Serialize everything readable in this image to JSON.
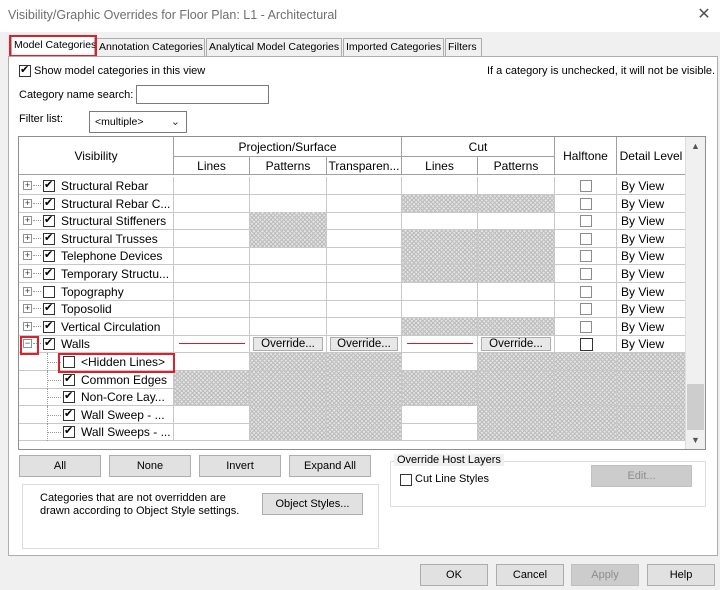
{
  "window": {
    "title": "Visibility/Graphic Overrides for Floor Plan: L1 - Architectural",
    "close_glyph": "✕"
  },
  "tabs": [
    {
      "label": "Model Categories",
      "active": true
    },
    {
      "label": "Annotation Categories"
    },
    {
      "label": "Analytical Model Categories"
    },
    {
      "label": "Imported Categories"
    },
    {
      "label": "Filters"
    }
  ],
  "show_model": {
    "label": "Show model categories in this view",
    "checked": true
  },
  "hint": "If a category is unchecked, it will not be visible.",
  "search": {
    "label": "Category name search:",
    "value": ""
  },
  "filter": {
    "label": "Filter list:",
    "value": "<multiple>"
  },
  "headers": {
    "visibility": "Visibility",
    "projection": "Projection/Surface",
    "cut": "Cut",
    "halftone": "Halftone",
    "detail_level": "Detail Level",
    "lines": "Lines",
    "patterns": "Patterns",
    "transparency": "Transparen...",
    "cut_lines": "Lines",
    "cut_patterns": "Patterns"
  },
  "rows": [
    {
      "name": "Structural Rebar",
      "checked": true,
      "expander": "+",
      "hatch": [],
      "detail": "By View"
    },
    {
      "name": "Structural Rebar C...",
      "checked": true,
      "expander": "+",
      "hatch": [
        "cut_lines",
        "cut_patterns"
      ],
      "detail": "By View"
    },
    {
      "name": "Structural Stiffeners",
      "checked": true,
      "expander": "+",
      "hatch": [
        "patterns"
      ],
      "detail": "By View"
    },
    {
      "name": "Structural Trusses",
      "checked": true,
      "expander": "+",
      "hatch": [
        "patterns",
        "cut_lines",
        "cut_patterns"
      ],
      "detail": "By View"
    },
    {
      "name": "Telephone Devices",
      "checked": true,
      "expander": "+",
      "hatch": [
        "cut_lines",
        "cut_patterns"
      ],
      "detail": "By View"
    },
    {
      "name": "Temporary Structu...",
      "checked": true,
      "expander": "+",
      "hatch": [
        "cut_lines",
        "cut_patterns"
      ],
      "detail": "By View"
    },
    {
      "name": "Topography",
      "checked": false,
      "expander": "+",
      "hatch": [],
      "detail": "By View"
    },
    {
      "name": "Toposolid",
      "checked": true,
      "expander": "+",
      "hatch": [],
      "detail": "By View"
    },
    {
      "name": "Vertical Circulation",
      "checked": true,
      "expander": "+",
      "hatch": [
        "cut_lines",
        "cut_patterns"
      ],
      "detail": "By View"
    },
    {
      "name": "Walls",
      "checked": true,
      "expander": "−",
      "special": "walls",
      "override_label": "Override...",
      "detail": "By View"
    },
    {
      "name": "<Hidden Lines>",
      "checked": false,
      "child": true,
      "hatch": [
        "patterns",
        "transparency",
        "cut_patterns",
        "halftone",
        "detail"
      ]
    },
    {
      "name": "Common Edges",
      "checked": true,
      "child": true,
      "hatch": [
        "lines",
        "patterns",
        "transparency",
        "cut_lines",
        "cut_patterns",
        "halftone",
        "detail"
      ]
    },
    {
      "name": "Non-Core Lay...",
      "checked": true,
      "child": true,
      "hatch": [
        "lines",
        "patterns",
        "transparency",
        "cut_lines",
        "cut_patterns",
        "halftone",
        "detail"
      ]
    },
    {
      "name": "Wall Sweep - ...",
      "checked": true,
      "child": true,
      "hatch": [
        "patterns",
        "transparency",
        "cut_patterns",
        "halftone",
        "detail"
      ]
    },
    {
      "name": "Wall Sweeps - ...",
      "checked": true,
      "child": true,
      "hatch": [
        "patterns",
        "transparency",
        "cut_patterns",
        "halftone",
        "detail"
      ]
    }
  ],
  "buttons": {
    "all": "All",
    "none": "None",
    "invert": "Invert",
    "expand_all": "Expand All"
  },
  "info": {
    "text": "Categories that are not overridden are drawn according to Object Style settings.",
    "object_styles": "Object Styles..."
  },
  "override_host": {
    "title": "Override Host Layers",
    "cut_line_styles": "Cut Line Styles",
    "edit": "Edit..."
  },
  "footer": {
    "ok": "OK",
    "cancel": "Cancel",
    "apply": "Apply",
    "help": "Help"
  },
  "colors": {
    "highlight": "#e01f2a",
    "override_line": "#c4262e"
  }
}
